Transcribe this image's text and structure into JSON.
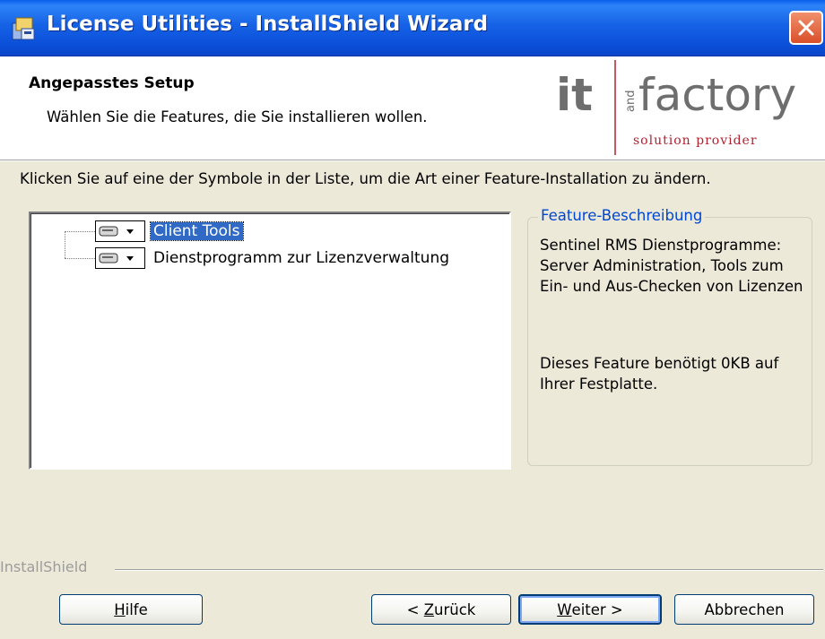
{
  "window": {
    "title": "License Utilities - InstallShield Wizard",
    "app_icon": "installer-icon",
    "close_icon": "close-icon"
  },
  "header": {
    "title": "Angepasstes Setup",
    "subtitle": "Wählen Sie die Features, die Sie installieren wollen.",
    "logo": {
      "text_it": "it",
      "text_and": "and",
      "text_factory": "factory",
      "tagline": "solution provider"
    }
  },
  "instruction": "Klicken Sie auf eine der Symbole in der Liste, um die Art einer Feature-Installation zu ändern.",
  "feature_tree": {
    "items": [
      {
        "label": "Client Tools",
        "icon": "drive-icon",
        "selected": true
      },
      {
        "label": "Dienstprogramm zur  Lizenzverwaltung",
        "icon": "drive-icon",
        "selected": false
      }
    ]
  },
  "description": {
    "legend": "Feature-Beschreibung",
    "text": "Sentinel RMS Dienstprogramme: Server Administration, Tools zum Ein- und Aus-Checken von Lizenzen",
    "size_info": "Dieses Feature benötigt 0KB auf Ihrer Festplatte."
  },
  "footer": {
    "brand": "InstallShield",
    "buttons": {
      "help": {
        "accel": "H",
        "rest": "ilfe"
      },
      "back": {
        "prefix": "< ",
        "accel": "Z",
        "rest": "urück"
      },
      "next": {
        "accel": "W",
        "rest": "eiter >"
      },
      "cancel": {
        "label": "Abbrechen"
      }
    }
  },
  "colors": {
    "titlebar": "#0B4FD9",
    "dialog_bg": "#ECE9D8",
    "selection": "#316AC5",
    "legend_text": "#0046D5",
    "logo_accent": "#B22030"
  }
}
